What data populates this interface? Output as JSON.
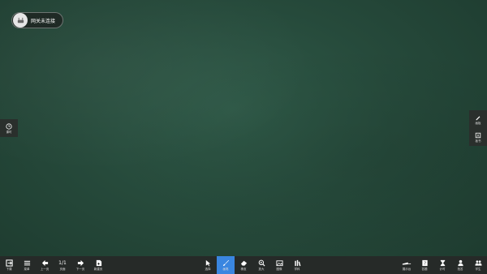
{
  "gateway": {
    "status": "网关未连接"
  },
  "left_panel": {
    "label": "课时"
  },
  "right_panel": {
    "items": [
      {
        "label": "画板",
        "icon": "pen-icon"
      },
      {
        "label": "板书",
        "icon": "board-icon"
      }
    ]
  },
  "toolbar": {
    "left": [
      {
        "label": "下课",
        "icon": "exit-icon"
      },
      {
        "label": "菜单",
        "icon": "menu-icon"
      },
      {
        "label": "上一页",
        "icon": "prev-arrow-icon"
      },
      {
        "label": "页面",
        "page": "1/1"
      },
      {
        "label": "下一页",
        "icon": "next-arrow-icon"
      },
      {
        "label": "新建页",
        "icon": "new-page-icon"
      }
    ],
    "center": [
      {
        "label": "选择",
        "icon": "cursor-icon"
      },
      {
        "label": "画笔",
        "icon": "brush-icon",
        "active": true
      },
      {
        "label": "橡皮",
        "icon": "eraser-icon"
      },
      {
        "label": "放大",
        "icon": "zoom-icon"
      },
      {
        "label": "图像",
        "icon": "image-icon"
      },
      {
        "label": "学科",
        "icon": "subject-icon"
      }
    ],
    "right": [
      {
        "label": "展示台",
        "icon": "camera-icon"
      },
      {
        "label": "答题",
        "icon": "question-icon"
      },
      {
        "label": "计时",
        "icon": "timer-icon"
      },
      {
        "label": "抢答",
        "icon": "person-icon"
      },
      {
        "label": "学生",
        "icon": "students-icon"
      }
    ]
  },
  "colors": {
    "board": "#264a3b",
    "toolbar": "#262a28",
    "active": "#3a86e0"
  }
}
